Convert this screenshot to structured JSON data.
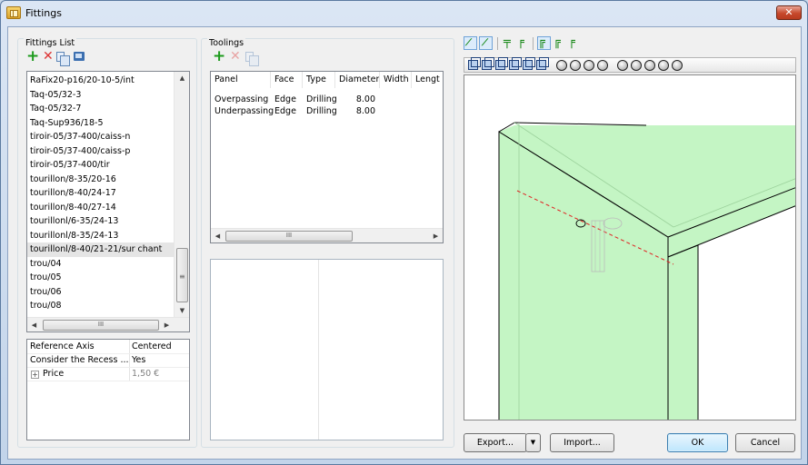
{
  "window": {
    "title": "Fittings",
    "close_glyph": "✕"
  },
  "fittings": {
    "group_label": "Fittings List",
    "toolbar": {
      "add": "add-icon",
      "delete": "delete-icon",
      "copy": "copy-icon",
      "export": "export-icon"
    },
    "items": [
      "RaFix20-p16/20-10-5/int",
      "Taq-05/32-3",
      "Taq-05/32-7",
      "Taq-Sup936/18-5",
      "tiroir-05/37-400/caiss-n",
      "tiroir-05/37-400/caiss-p",
      "tiroir-05/37-400/tir",
      "tourillon/8-35/20-16",
      "tourillon/8-40/24-17",
      "tourillon/8-40/27-14",
      "tourillonl/6-35/24-13",
      "tourillonl/8-35/24-13",
      "tourillonl/8-40/21-21/sur chant",
      "trou/04",
      "trou/05",
      "trou/06",
      "trou/08"
    ],
    "selected_index": 12,
    "hscroll_mid": "III"
  },
  "properties": {
    "rows": [
      {
        "name": "Reference Axis",
        "value": "Centered"
      },
      {
        "name": "Consider the Recess ...",
        "value": "Yes"
      },
      {
        "name": "Price",
        "value": "1,50 €",
        "expander": "+"
      }
    ]
  },
  "toolings": {
    "group_label": "Toolings",
    "columns": [
      "Panel",
      "Face",
      "Type",
      "Diameter",
      "Width",
      "Lengt"
    ],
    "rows": [
      [
        "Overpassing",
        "Edge",
        "Drilling",
        "8.00"
      ],
      [
        "Underpassing",
        "Edge",
        "Drilling",
        "8.00"
      ]
    ],
    "hscroll_mid": "III"
  },
  "viewer": {
    "fill_color": "#c4f5c4",
    "edge_color": "#000000",
    "axis_color": "#e02020"
  },
  "buttons": {
    "export": "Export...",
    "import": "Import...",
    "ok": "OK",
    "cancel": "Cancel"
  }
}
